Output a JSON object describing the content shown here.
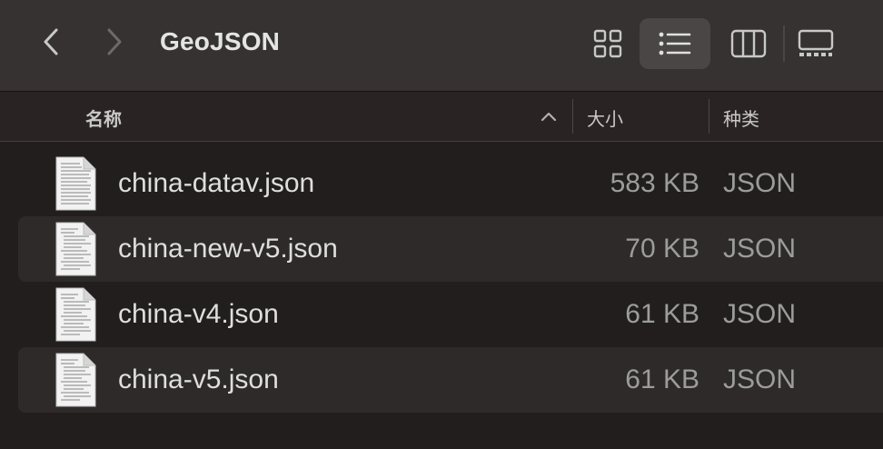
{
  "toolbar": {
    "title": "GeoJSON",
    "back_icon": "chevron-left-icon",
    "forward_icon": "chevron-right-icon",
    "view_modes": [
      "icon-view",
      "list-view",
      "column-view",
      "gallery-view"
    ],
    "active_view": "list-view"
  },
  "header": {
    "name_label": "名称",
    "size_label": "大小",
    "kind_label": "种类",
    "sort_indicator": "chevron-up-icon"
  },
  "files": [
    {
      "name": "china-datav.json",
      "size": "583 KB",
      "kind": "JSON"
    },
    {
      "name": "china-new-v5.json",
      "size": "70 KB",
      "kind": "JSON"
    },
    {
      "name": "china-v4.json",
      "size": "61 KB",
      "kind": "JSON"
    },
    {
      "name": "china-v5.json",
      "size": "61 KB",
      "kind": "JSON"
    }
  ],
  "colors": {
    "toolbar_bg": "#363232",
    "header_bg": "#2a2323",
    "window_bg": "#221e1e",
    "alt_row_bg": "#2e2a2a",
    "selected_view_bg": "#4a4646"
  }
}
